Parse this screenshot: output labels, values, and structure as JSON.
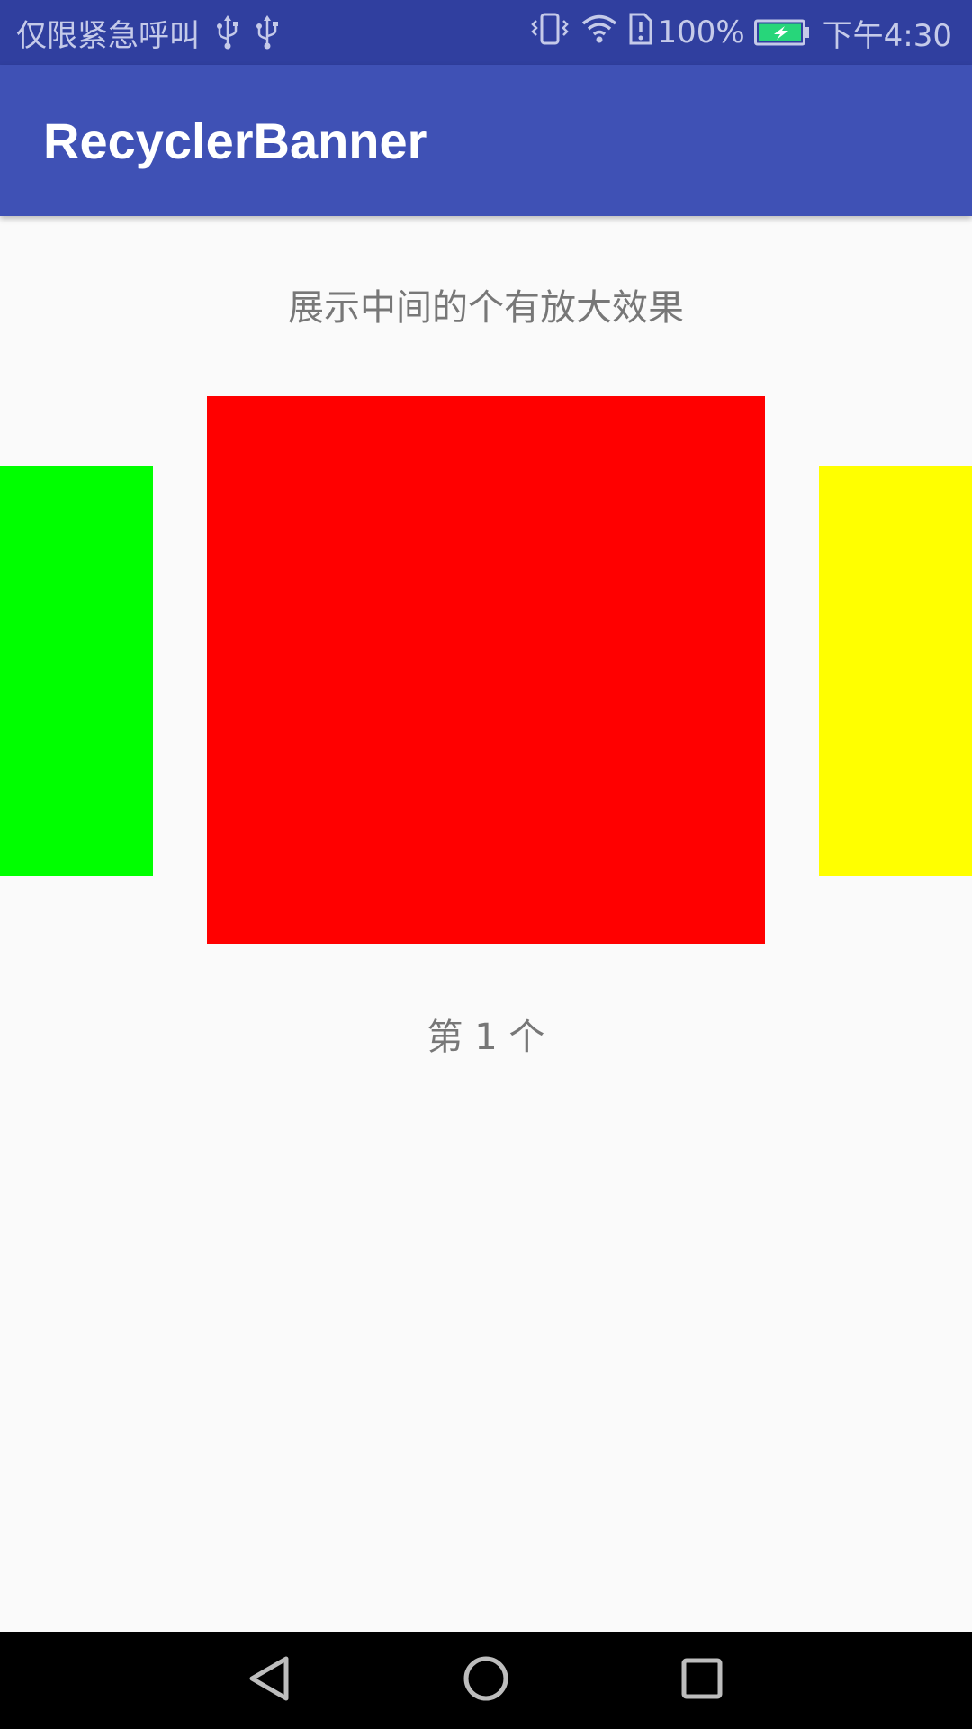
{
  "status_bar": {
    "carrier_text": "仅限紧急呼叫",
    "battery_percent": "100%",
    "time": "下午4:30",
    "icons": [
      "usb-icon",
      "usb-icon",
      "vibrate-icon",
      "wifi-icon",
      "sim-alert-icon",
      "battery-charging-icon"
    ],
    "battery_level": 1.0
  },
  "app_bar": {
    "title": "RecyclerBanner"
  },
  "main": {
    "subtitle": "展示中间的个有放大效果",
    "banner": {
      "items": [
        {
          "position": "left",
          "color": "#00ff00"
        },
        {
          "position": "center",
          "color": "#ff0000"
        },
        {
          "position": "right",
          "color": "#ffff00"
        }
      ]
    },
    "indicator": "第 1 个"
  },
  "nav_bar": {
    "buttons": [
      "back-icon",
      "home-icon",
      "recent-apps-icon"
    ]
  },
  "colors": {
    "status_bar": "#303f9f",
    "app_bar": "#3f51b5",
    "background": "#fafafa",
    "text_secondary": "#777777"
  }
}
